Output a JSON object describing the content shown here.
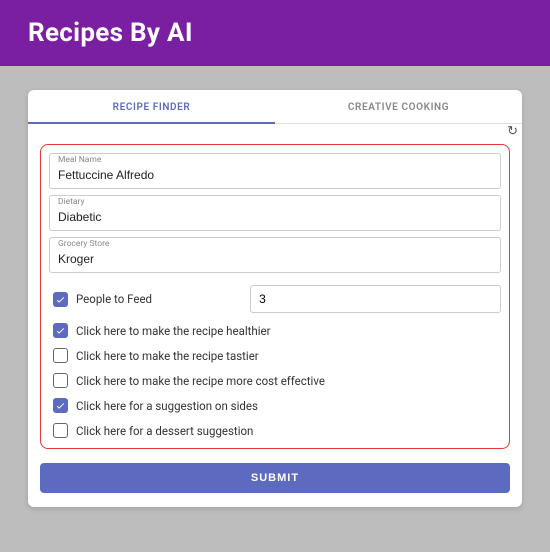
{
  "header": {
    "title": "Recipes By AI"
  },
  "tabs": {
    "recipe_finder": "RECIPE FINDER",
    "creative_cooking": "CREATIVE COOKING"
  },
  "form": {
    "meal_name": {
      "label": "Meal Name",
      "value": "Fettuccine Alfredo"
    },
    "dietary": {
      "label": "Dietary",
      "value": "Diabetic"
    },
    "grocery": {
      "label": "Grocery Store",
      "value": "Kroger"
    },
    "people": {
      "label": "People to Feed",
      "value": "3",
      "checked": true
    },
    "options": [
      {
        "label": "Click here to make the recipe healthier",
        "checked": true
      },
      {
        "label": "Click here to make the recipe tastier",
        "checked": false
      },
      {
        "label": "Click here to make the recipe more cost effective",
        "checked": false
      },
      {
        "label": "Click here for a suggestion on sides",
        "checked": true
      },
      {
        "label": "Click here for a dessert suggestion",
        "checked": false
      }
    ]
  },
  "submit_label": "SUBMIT"
}
